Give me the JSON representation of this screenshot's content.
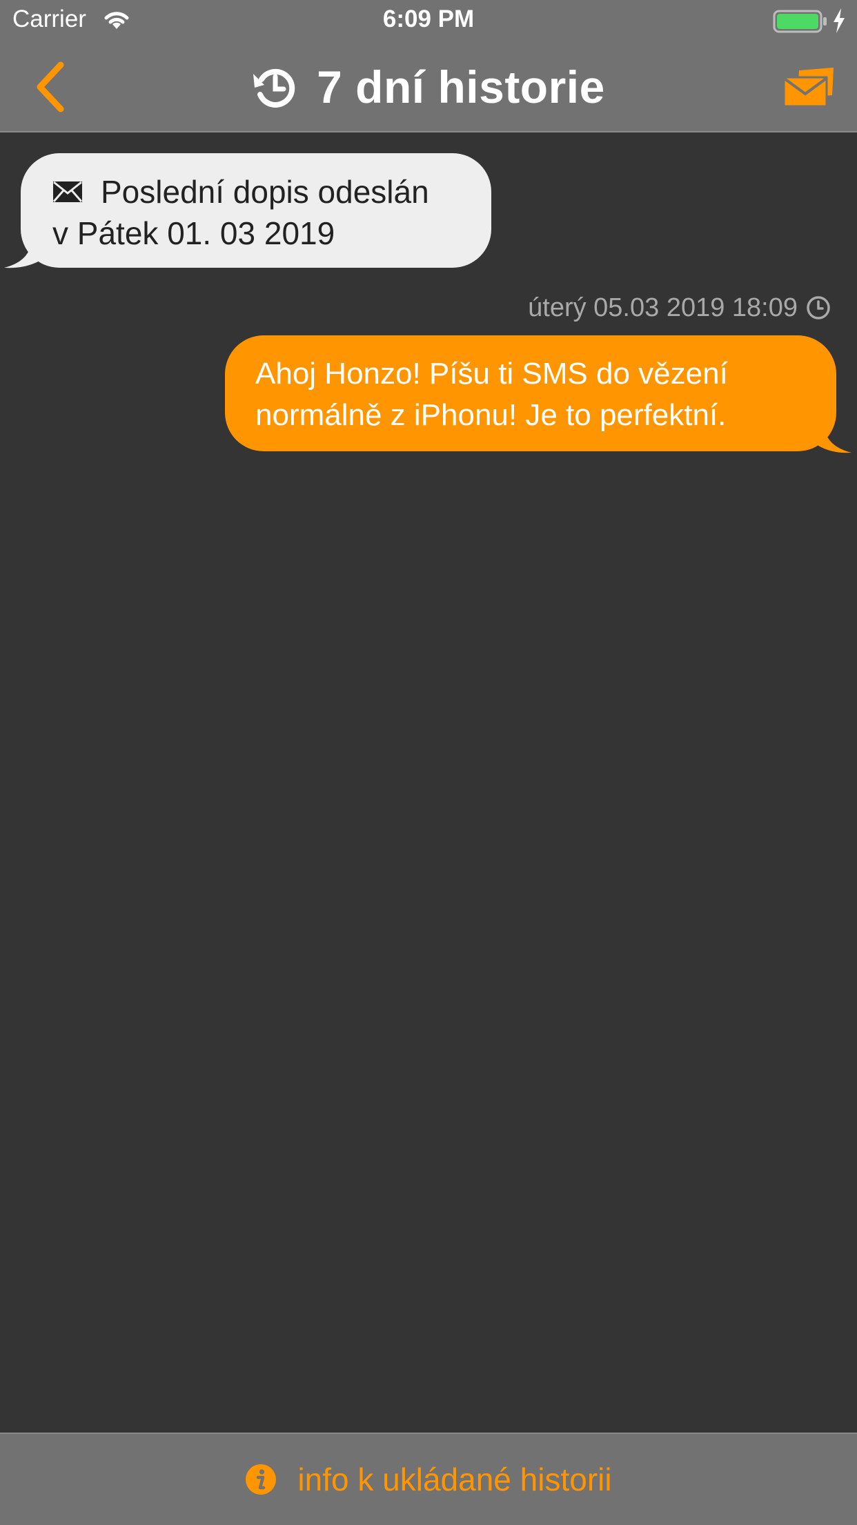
{
  "status_bar": {
    "carrier": "Carrier",
    "time": "6:09 PM"
  },
  "nav": {
    "title": "7 dní historie",
    "back_icon": "chevron-left-icon",
    "title_icon": "history-icon",
    "action_icon": "mail-send-icon"
  },
  "messages": [
    {
      "direction": "incoming",
      "icon": "envelope-icon",
      "line1": "Poslední dopis odeslán",
      "line2": "v Pátek 01. 03 2019"
    },
    {
      "direction": "outgoing",
      "timestamp": "úterý 05.03 2019 18:09",
      "line1": "Ahoj Honzo! Píšu ti SMS do vězení",
      "line2": "normálně z iPhonu! Je to perfektní."
    }
  ],
  "footer": {
    "info_icon": "info-icon",
    "label": "info k ukládané historii"
  },
  "colors": {
    "accent": "#ff9500",
    "background": "#343434",
    "bar": "#727272",
    "incoming_bubble": "#eeeeee",
    "battery": "#4cd964"
  }
}
